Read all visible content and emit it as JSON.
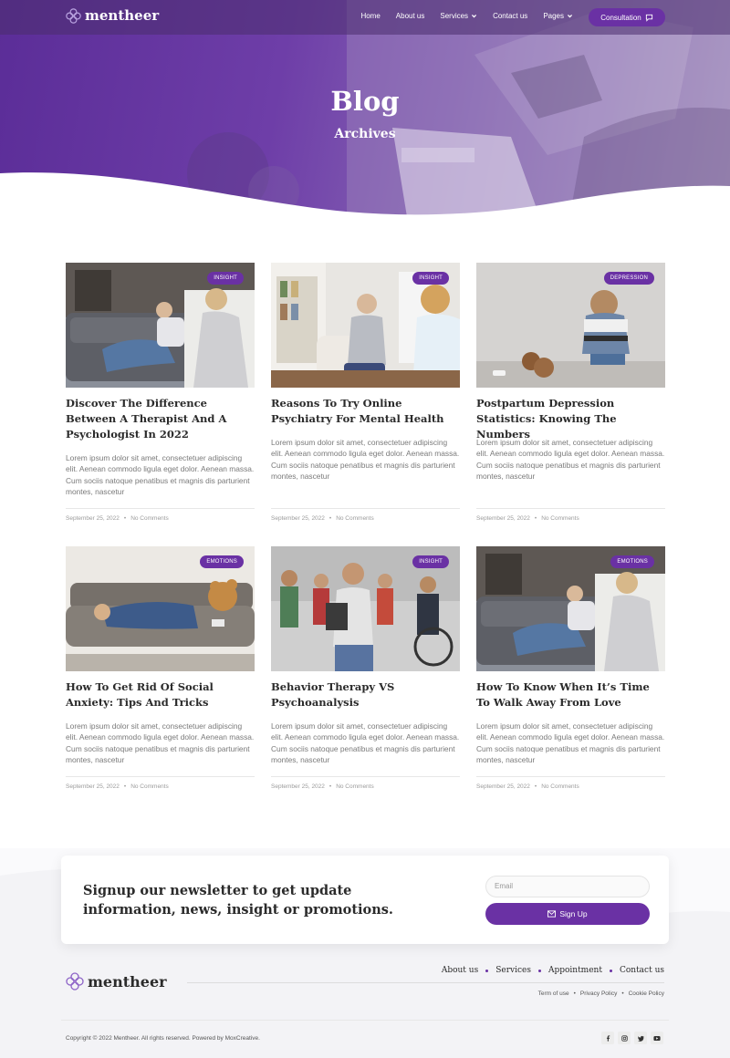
{
  "nav": {
    "logo": "mentheer",
    "links": [
      {
        "label": "Home"
      },
      {
        "label": "About us"
      },
      {
        "label": "Services",
        "dropdown": true
      },
      {
        "label": "Contact us"
      },
      {
        "label": "Pages",
        "dropdown": true
      }
    ],
    "cta": "Consultation"
  },
  "hero": {
    "title": "Blog",
    "subtitle": "Archives"
  },
  "posts": [
    {
      "badge": "INSIGHT",
      "title": "Discover The Difference Between A Therapist And A Psychologist In 2022",
      "excerpt": "Lorem ipsum dolor sit amet, consectetuer adipiscing elit. Aenean commodo ligula eget dolor. Aenean massa. Cum sociis natoque penatibus et magnis dis parturient montes, nascetur",
      "date": "September 25, 2022",
      "comments": "No Comments"
    },
    {
      "badge": "INSIGHT",
      "title": "Reasons To Try Online Psychiatry For Mental Health",
      "excerpt": "Lorem ipsum dolor sit amet, consectetuer adipiscing elit. Aenean commodo ligula eget dolor. Aenean massa. Cum sociis natoque penatibus et magnis dis parturient montes, nascetur",
      "date": "September 25, 2022",
      "comments": "No Comments"
    },
    {
      "badge": "DEPRESSION",
      "title": "Postpartum Depression Statistics: Knowing The Numbers",
      "excerpt": "Lorem ipsum dolor sit amet, consectetuer adipiscing elit. Aenean commodo ligula eget dolor. Aenean massa. Cum sociis natoque penatibus et magnis dis parturient montes, nascetur",
      "date": "September 25, 2022",
      "comments": "No Comments"
    },
    {
      "badge": "EMOTIONS",
      "title": "How To Get Rid Of Social Anxiety: Tips And Tricks",
      "excerpt": "Lorem ipsum dolor sit amet, consectetuer adipiscing elit. Aenean commodo ligula eget dolor. Aenean massa. Cum sociis natoque penatibus et magnis dis parturient montes, nascetur",
      "date": "September 25, 2022",
      "comments": "No Comments"
    },
    {
      "badge": "INSIGHT",
      "title": "Behavior Therapy VS Psychoanalysis",
      "excerpt": "Lorem ipsum dolor sit amet, consectetuer adipiscing elit. Aenean commodo ligula eget dolor. Aenean massa. Cum sociis natoque penatibus et magnis dis parturient montes, nascetur",
      "date": "September 25, 2022",
      "comments": "No Comments"
    },
    {
      "badge": "EMOTIONS",
      "title": "How To Know When It’s Time To Walk Away From Love",
      "excerpt": "Lorem ipsum dolor sit amet, consectetuer adipiscing elit. Aenean commodo ligula eget dolor. Aenean massa. Cum sociis natoque penatibus et magnis dis parturient montes, nascetur",
      "date": "September 25, 2022",
      "comments": "No Comments"
    }
  ],
  "newsletter": {
    "heading": "Signup our newsletter to get update information, news, insight or promotions.",
    "email_placeholder": "Email",
    "button": "Sign Up"
  },
  "footer": {
    "logo": "mentheer",
    "menu": [
      "About us",
      "Services",
      "Appointment",
      "Contact us"
    ],
    "legal": [
      "Term of use",
      "Privacy Policy",
      "Cookie Policy"
    ],
    "copyright": "Copyright © 2022 Mentheer. All rights reserved. Powered by MoxCreative.",
    "socials": [
      "facebook-icon",
      "instagram-icon",
      "twitter-icon",
      "youtube-icon"
    ]
  },
  "colors": {
    "accent": "#6a31a4",
    "text": "#2b2b2b",
    "muted": "#7a7a7a"
  }
}
